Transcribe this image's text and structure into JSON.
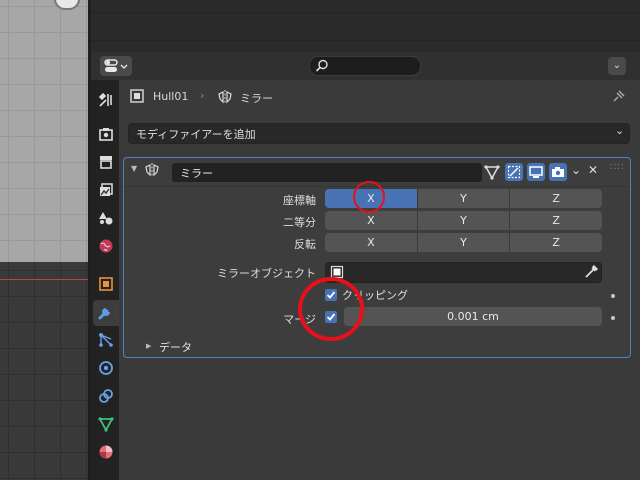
{
  "header": {
    "search_placeholder": "",
    "dropdown_glyph": "⌄"
  },
  "breadcrumb": {
    "object_name": "Hull01",
    "separator": "›",
    "modifier_name": "ミラー"
  },
  "add_modifier": {
    "label": "モディファイアーを追加",
    "chevron": "⌄"
  },
  "modifier": {
    "name": "ミラー",
    "collapse_glyph": "▼",
    "close_glyph": "✕",
    "rows": {
      "axis": {
        "label": "座標軸",
        "options": [
          "X",
          "Y",
          "Z"
        ],
        "active": "X"
      },
      "bisect": {
        "label": "二等分",
        "options": [
          "X",
          "Y",
          "Z"
        ]
      },
      "flip": {
        "label": "反転",
        "options": [
          "X",
          "Y",
          "Z"
        ]
      }
    },
    "mirror_object": {
      "label": "ミラーオブジェクト",
      "value": ""
    },
    "clipping": {
      "label": "クリッピング",
      "checked": true
    },
    "merge": {
      "label": "マージ",
      "checked": true,
      "value": "0.001 cm"
    },
    "data_section": {
      "label": "データ",
      "arrow": "▶"
    }
  },
  "colors": {
    "accent": "#4772b3",
    "highlight_ring": "#e8101a",
    "panel_bg": "#3a3a3a",
    "outline": "#5080c0"
  },
  "icons": [
    "editor-type-icon",
    "search-icon",
    "object-data-icon",
    "modifier-icon",
    "pin-icon",
    "tool-icon",
    "render-icon",
    "output-icon",
    "view-layer-icon",
    "scene-icon",
    "world-icon",
    "object-icon",
    "wrench-icon",
    "particles-icon",
    "physics-icon",
    "constraints-icon",
    "data-icon",
    "material-icon",
    "editmode-icon",
    "onCage-icon",
    "viewport-icon",
    "camera-icon",
    "eyedropper-icon"
  ]
}
